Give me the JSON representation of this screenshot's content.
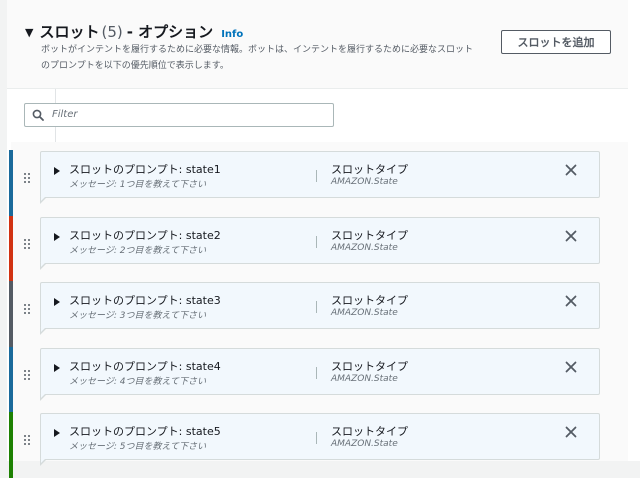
{
  "section": {
    "title": "スロット",
    "count": "(5)",
    "separator": "- オプション",
    "info_label": "Info",
    "description": "ボットがインテントを履行するために必要な情報。ボットは、インテントを履行するために必要なスロットのプロンプトを以下の優先順位で表示します。",
    "add_button_label": "スロットを追加"
  },
  "filter": {
    "placeholder": "Filter",
    "icon": "search-icon"
  },
  "slots": [
    {
      "prompt_label": "スロットのプロンプト: state1",
      "message": "メッセージ: 1つ目を教えて下さい",
      "type_label": "スロットタイプ",
      "type_value": "AMAZON.State",
      "color": "#1a6a9b"
    },
    {
      "prompt_label": "スロットのプロンプト: state2",
      "message": "メッセージ: 2つ目を教えて下さい",
      "type_label": "スロットタイプ",
      "type_value": "AMAZON.State",
      "color": "#d13212"
    },
    {
      "prompt_label": "スロットのプロンプト: state3",
      "message": "メッセージ: 3つ目を教えて下さい",
      "type_label": "スロットタイプ",
      "type_value": "AMAZON.State",
      "color": "#545b64"
    },
    {
      "prompt_label": "スロットのプロンプト: state4",
      "message": "メッセージ: 4つ目を教えて下さい",
      "type_label": "スロットタイプ",
      "type_value": "AMAZON.State",
      "color": "#1a6a9b"
    },
    {
      "prompt_label": "スロットのプロンプト: state5",
      "message": "メッセージ: 5つ目を教えて下さい",
      "type_label": "スロットタイプ",
      "type_value": "AMAZON.State",
      "color": "#1d8102"
    }
  ],
  "colors": {
    "accent": "#0073bb"
  }
}
